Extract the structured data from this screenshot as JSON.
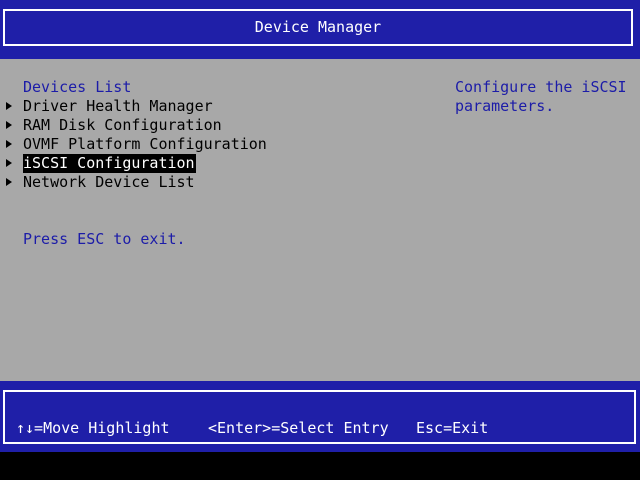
{
  "header": {
    "title": "Device Manager"
  },
  "main": {
    "section_title": "Devices List",
    "items": [
      {
        "label": "Driver Health Manager",
        "selected": false
      },
      {
        "label": "RAM Disk Configuration",
        "selected": false
      },
      {
        "label": "OVMF Platform Configuration",
        "selected": false
      },
      {
        "label": "iSCSI Configuration",
        "selected": true
      },
      {
        "label": "Network Device List",
        "selected": false
      }
    ],
    "exit_hint": "Press ESC to exit.",
    "help_text": "Configure the iSCSI\nparameters."
  },
  "footer": {
    "move_hint": "↑↓=Move Highlight",
    "enter_hint": "<Enter>=Select Entry",
    "esc_hint": "Esc=Exit"
  },
  "colors": {
    "header_bg": "#1f1fa8",
    "main_bg": "#a8a8a8",
    "accent_text": "#1c1ca8",
    "selected_bg": "#000000",
    "selected_text": "#ffffff"
  },
  "icons": {
    "menu_item_marker": "triangle-right-icon"
  }
}
